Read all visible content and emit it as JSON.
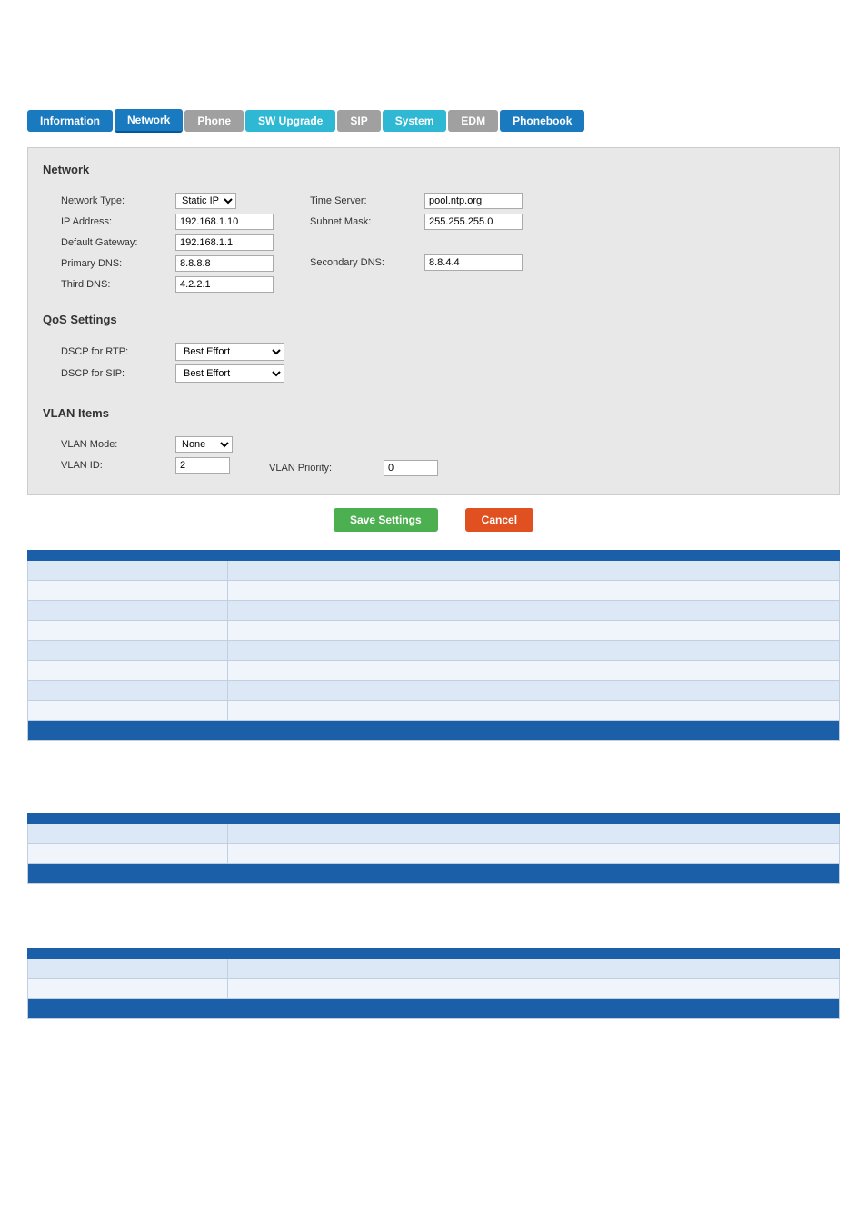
{
  "nav": {
    "tabs": [
      {
        "id": "information",
        "label": "Information",
        "style": "blue"
      },
      {
        "id": "network",
        "label": "Network",
        "style": "active"
      },
      {
        "id": "phone",
        "label": "Phone",
        "style": "gray"
      },
      {
        "id": "sw-upgrade",
        "label": "SW Upgrade",
        "style": "cyan"
      },
      {
        "id": "sip",
        "label": "SIP",
        "style": "gray"
      },
      {
        "id": "system",
        "label": "System",
        "style": "cyan"
      },
      {
        "id": "edm",
        "label": "EDM",
        "style": "gray"
      },
      {
        "id": "phonebook",
        "label": "Phonebook",
        "style": "blue"
      }
    ]
  },
  "networkSection": {
    "title": "Network",
    "fields": {
      "networkType": {
        "label": "Network Type:",
        "value": "Static IP"
      },
      "ipAddress": {
        "label": "IP Address:",
        "value": "192.168.1.10"
      },
      "defaultGateway": {
        "label": "Default Gateway:",
        "value": "192.168.1.1"
      },
      "primaryDNS": {
        "label": "Primary DNS:",
        "value": "8.8.8.8"
      },
      "thirdDNS": {
        "label": "Third DNS:",
        "value": "4.2.2.1"
      },
      "timeServer": {
        "label": "Time Server:",
        "value": "pool.ntp.org"
      },
      "subnetMask": {
        "label": "Subnet Mask:",
        "value": "255.255.255.0"
      },
      "secondaryDNS": {
        "label": "Secondary DNS:",
        "value": "8.8.4.4"
      }
    }
  },
  "qosSection": {
    "title": "QoS Settings",
    "fields": {
      "dscpRTP": {
        "label": "DSCP for RTP:",
        "value": "Best Effort"
      },
      "dscpSIP": {
        "label": "DSCP for SIP:",
        "value": "Best Effort"
      }
    }
  },
  "vlanSection": {
    "title": "VLAN Items",
    "fields": {
      "vlanMode": {
        "label": "VLAN Mode:",
        "value": "None"
      },
      "vlanId": {
        "label": "VLAN ID:",
        "value": "2"
      },
      "vlanPriority": {
        "label": "VLAN Priority:",
        "value": "0"
      }
    }
  },
  "buttons": {
    "save": "Save Settings",
    "cancel": "Cancel"
  },
  "table1": {
    "columns": [
      "",
      ""
    ],
    "rows": [
      [
        "",
        ""
      ],
      [
        "",
        ""
      ],
      [
        "",
        ""
      ],
      [
        "",
        ""
      ],
      [
        "",
        ""
      ],
      [
        "",
        ""
      ],
      [
        "",
        ""
      ],
      [
        "",
        ""
      ]
    ]
  },
  "table2": {
    "columns": [
      "",
      ""
    ],
    "rows": [
      [
        "",
        ""
      ],
      [
        "",
        ""
      ]
    ]
  },
  "table3": {
    "columns": [
      "",
      ""
    ],
    "rows": [
      [
        "",
        ""
      ],
      [
        "",
        ""
      ]
    ]
  }
}
